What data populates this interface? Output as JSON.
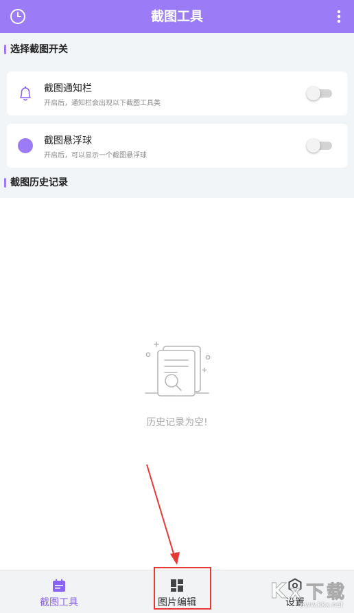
{
  "app_bar": {
    "title": "截图工具",
    "left_icon": "history-clock-icon",
    "right_icon": "more-vertical-icon",
    "color": "#9b7cf6"
  },
  "section_toggles": {
    "title": "选择截图开关",
    "items": [
      {
        "label": "截图通知栏",
        "description": "开启后，通知栏会出现以下截图工具类",
        "icon": "bell-icon",
        "enabled": false
      },
      {
        "label": "截图悬浮球",
        "description": "开启后，可以显示一个截图悬浮球",
        "icon": "floating-ball-icon",
        "enabled": false
      }
    ]
  },
  "section_history": {
    "title": "截图历史记录",
    "empty_text": "历史记录为空!"
  },
  "bottom_nav": {
    "items": [
      {
        "label": "截图工具",
        "icon": "calendar-icon",
        "active": true
      },
      {
        "label": "图片编辑",
        "icon": "grid-tiles-icon",
        "active": false
      },
      {
        "label": "设置",
        "icon": "settings-hex-icon",
        "active": false
      }
    ]
  },
  "watermark": {
    "text": "www.kkx.net"
  },
  "colors": {
    "accent": "#9b7cf6",
    "active_label": "#8a63f2",
    "annotation": "#e53935"
  }
}
